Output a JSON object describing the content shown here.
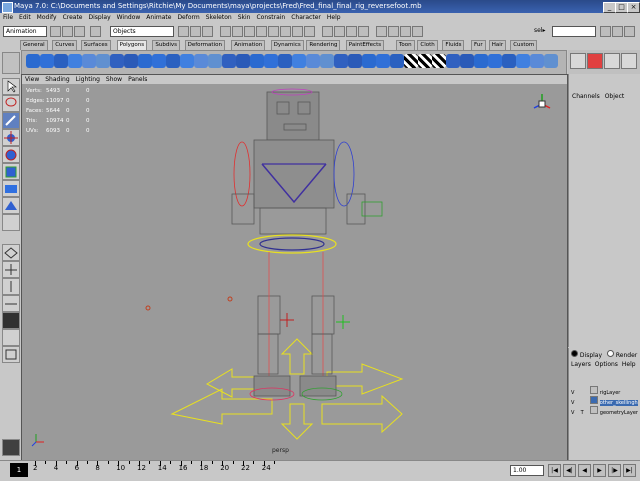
{
  "window": {
    "title": "Maya 7.0: C:\\Documents and Settings\\Ritchie\\My Documents\\maya\\projects\\Fred\\Fred_final_final_rig_reversefoot.mb",
    "min": "_",
    "max": "□",
    "close": "×"
  },
  "menubar": [
    "File",
    "Edit",
    "Modify",
    "Create",
    "Display",
    "Window",
    "Animate",
    "Deform",
    "Skeleton",
    "Skin",
    "Constrain",
    "Character",
    "Help"
  ],
  "statusline": {
    "menu_set": "Animation",
    "selection_mode": "Objects",
    "sel_label": "sel▸"
  },
  "shelf_tabs": [
    "General",
    "Curves",
    "Surfaces",
    "Polygons",
    "Subdivs",
    "Deformation",
    "Animation",
    "Dynamics",
    "Rendering",
    "PaintEffects",
    "Toon",
    "Cloth",
    "Fluids",
    "Fur",
    "Hair",
    "Custom"
  ],
  "active_shelf_tab": "Polygons",
  "viewport": {
    "menu": [
      "View",
      "Shading",
      "Lighting",
      "Show",
      "Panels"
    ],
    "hud": [
      {
        "label": "Verts:",
        "v1": "5493",
        "v2": "0",
        "v3": "0"
      },
      {
        "label": "Edges:",
        "v1": "11097",
        "v2": "0",
        "v3": "0"
      },
      {
        "label": "Faces:",
        "v1": "5644",
        "v2": "0",
        "v3": "0"
      },
      {
        "label": "Tris:",
        "v1": "10974",
        "v2": "0",
        "v3": "0"
      },
      {
        "label": "UVs:",
        "v1": "6093",
        "v2": "0",
        "v3": "0"
      }
    ],
    "camera_label": "persp"
  },
  "channel_box": {
    "tabs": [
      "Channels",
      "Object"
    ]
  },
  "layer_editor": {
    "display_radio": "Display",
    "render_radio": "Render",
    "menu": [
      "Layers",
      "Options",
      "Help"
    ],
    "layers": [
      {
        "v": "V",
        "t": "",
        "name": "rigLayer",
        "selected": false
      },
      {
        "v": "V",
        "t": "",
        "name": "other_skellingh",
        "selected": true
      },
      {
        "v": "V",
        "t": "T",
        "name": "geometryLayer",
        "selected": false
      }
    ]
  },
  "timeline": {
    "current_frame": "1",
    "ticks": [
      "2",
      "4",
      "6",
      "8",
      "10",
      "12",
      "14",
      "16",
      "18",
      "20",
      "22",
      "24"
    ],
    "current_time_field": "1.00",
    "playback": [
      "|◀",
      "◀|",
      "◀",
      "▶",
      "|▶",
      "▶|"
    ]
  },
  "colors": {
    "viewport_bg": "#9a9a9a",
    "titlebar": "#2a4a8a",
    "selection_highlight": "#3a6ab0"
  }
}
